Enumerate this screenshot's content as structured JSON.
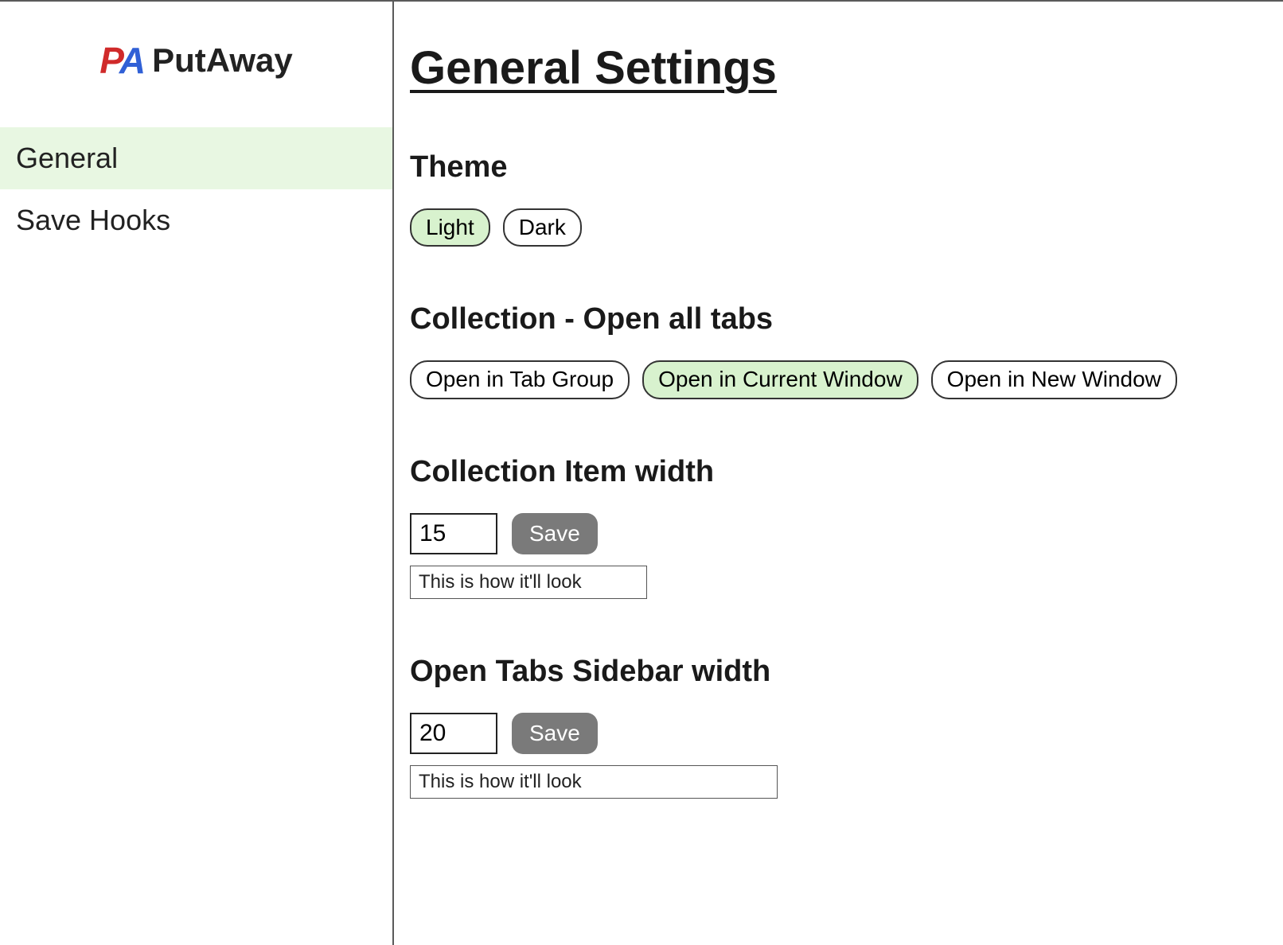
{
  "app": {
    "name": "PutAway",
    "logo": {
      "p": "P",
      "a": "A"
    }
  },
  "sidebar": {
    "items": [
      {
        "label": "General",
        "active": true
      },
      {
        "label": "Save Hooks",
        "active": false
      }
    ]
  },
  "main": {
    "title": "General Settings",
    "theme": {
      "heading": "Theme",
      "options": [
        {
          "label": "Light",
          "selected": true
        },
        {
          "label": "Dark",
          "selected": false
        }
      ]
    },
    "openAllTabs": {
      "heading": "Collection - Open all tabs",
      "options": [
        {
          "label": "Open in Tab Group",
          "selected": false
        },
        {
          "label": "Open in Current Window",
          "selected": true
        },
        {
          "label": "Open in New Window",
          "selected": false
        }
      ]
    },
    "collectionItemWidth": {
      "heading": "Collection Item width",
      "value": "15",
      "saveLabel": "Save",
      "preview": "This is how it'll look"
    },
    "sidebarWidth": {
      "heading": "Open Tabs Sidebar width",
      "value": "20",
      "saveLabel": "Save",
      "preview": "This is how it'll look"
    }
  }
}
